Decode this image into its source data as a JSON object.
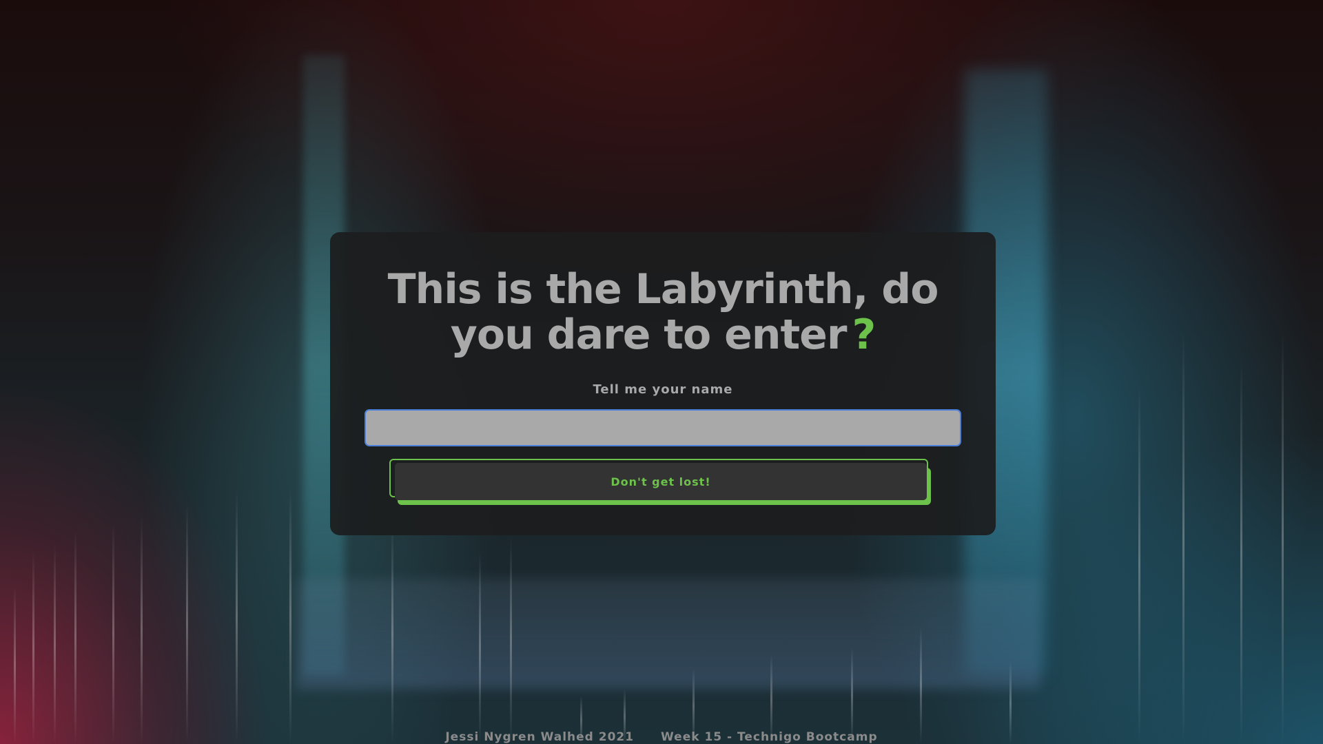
{
  "card": {
    "title_main": "This is the Labyrinth, do you dare to enter",
    "title_mark": "?",
    "name_label": "Tell me your name",
    "name_value": "",
    "name_placeholder": "",
    "submit_label": "Don't get lost!"
  },
  "footer": {
    "author": "Jessi Nygren Walhed 2021",
    "course": "Week 15 - Technigo Bootcamp"
  },
  "colors": {
    "accent": "#6cc24a",
    "text": "#a9a9a9",
    "card_bg": "#1c1d1e",
    "input_border": "#4c7fd9"
  }
}
